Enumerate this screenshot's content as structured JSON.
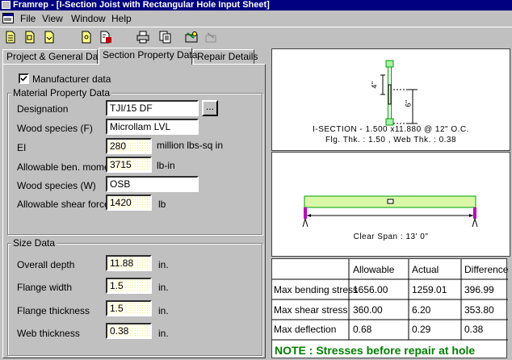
{
  "window": {
    "title": "Framrep - [I-Section Joist with Rectangular Hole Input Sheet]"
  },
  "menu": [
    {
      "label": "File"
    },
    {
      "label": "View"
    },
    {
      "label": "Window"
    },
    {
      "label": "Help"
    }
  ],
  "toolbar": {
    "icons": [
      "new-icon",
      "open-icon",
      "save-icon",
      "preview-icon",
      "export-icon",
      "print-icon",
      "copy-icon",
      "calculate-icon",
      "disabled-tool-icon"
    ]
  },
  "tabs": [
    {
      "label": "Project & General Data",
      "active": false
    },
    {
      "label": "Section Property Data",
      "active": true
    },
    {
      "label": "Repair Details",
      "active": false
    }
  ],
  "manufacturer": {
    "label": "Manufacturer data",
    "checked": true
  },
  "material": {
    "title": "Material Property Data",
    "designation": {
      "label": "Designation",
      "value": "TJI/15 DF",
      "browse": "..."
    },
    "wood_species_f": {
      "label": "Wood species (F)",
      "value": "Microllam LVL"
    },
    "ei": {
      "label": "EI",
      "value": "280",
      "unit": "million lbs-sq in"
    },
    "moment": {
      "label": "Allowable ben. moment",
      "value": "3715",
      "unit": "lb-in"
    },
    "wood_species_w": {
      "label": "Wood species (W)",
      "value": "OSB"
    },
    "shear": {
      "label": "Allowable shear force",
      "value": "1420",
      "unit": "lb"
    }
  },
  "size": {
    "title": "Size Data",
    "depth": {
      "label": "Overall depth",
      "value": "11.88",
      "unit": "in."
    },
    "flange_width": {
      "label": "Flange width",
      "value": "1.5",
      "unit": "in."
    },
    "flange_thickness": {
      "label": "Flange thickness",
      "value": "1.5",
      "unit": "in."
    },
    "web_thickness": {
      "label": "Web thickness",
      "value": "0.38",
      "unit": "in."
    }
  },
  "section_sketch": {
    "dim_left": "4\"",
    "dim_right": "6\"",
    "caption1": "I-SECTION - 1.500 x11.880  @ 12\" O.C.",
    "caption2": "Flg. Thk. : 1.50 , Web Thk. : 0.38"
  },
  "beam_sketch": {
    "clear_span": "Clear Span : 13' 0\""
  },
  "stress_table": {
    "headers": [
      "",
      "Allowable",
      "Actual",
      "Difference"
    ],
    "rows": [
      {
        "label": "Max bending stress",
        "allowable": "1656.00",
        "actual": "1259.01",
        "difference": "396.99"
      },
      {
        "label": "Max shear stress",
        "allowable": "360.00",
        "actual": "6.20",
        "difference": "353.80"
      },
      {
        "label": "Max deflection",
        "allowable": "0.68",
        "actual": "0.29",
        "difference": "0.38"
      }
    ],
    "note": "NOTE : Stresses before repair at hole"
  },
  "colors": {
    "title_bar": "#000080",
    "note": "#008000",
    "sketch_green": "#00a000",
    "sketch_magenta": "#c000c0"
  }
}
